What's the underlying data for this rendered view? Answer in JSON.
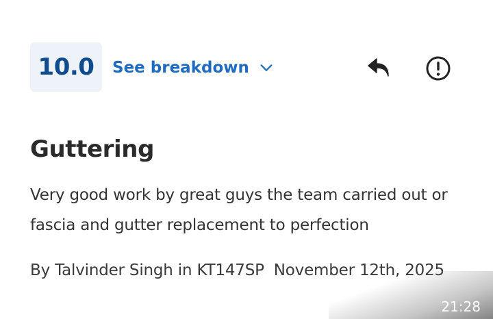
{
  "review": {
    "score": "10.0",
    "breakdown_label": "See breakdown",
    "title": "Guttering",
    "body": "Very good work by great guys the team carried out or fascia and gutter replacement to perfection",
    "author": "By Talvinder Singh in KT147SP",
    "date": "November 12th, 2025"
  },
  "status_bar": {
    "time": "21:28"
  },
  "icons": {
    "breakdown": "chevron-down-icon",
    "reply": "reply-icon",
    "report": "report-icon"
  },
  "colors": {
    "score_text": "#0f4c8f",
    "score_bg": "#eef3f9",
    "link": "#1f6bbf",
    "title": "#2b2b2b",
    "body_text": "#333333"
  }
}
